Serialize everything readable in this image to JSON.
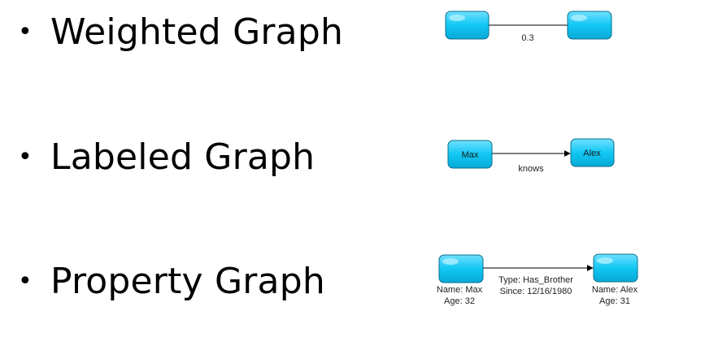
{
  "bullets": [
    {
      "symbol": "•",
      "label": "Weighted Graph"
    },
    {
      "symbol": "•",
      "label": "Labeled Graph"
    },
    {
      "symbol": "•",
      "label": "Property Graph"
    }
  ],
  "weighted": {
    "edge_label": "0.3"
  },
  "labeled": {
    "source": "Max",
    "target": "Alex",
    "edge_label": "knows"
  },
  "property": {
    "source_prop1": "Name: Max",
    "source_prop2": "Age: 32",
    "target_prop1": "Name: Alex",
    "target_prop2": "Age: 31",
    "edge_prop1": "Type: Has_Brother",
    "edge_prop2": "Since: 12/16/1980"
  },
  "colors": {
    "node_fill": "#11c7f3",
    "node_border": "#0a6f8c",
    "edge": "#000000",
    "text": "#000000"
  }
}
